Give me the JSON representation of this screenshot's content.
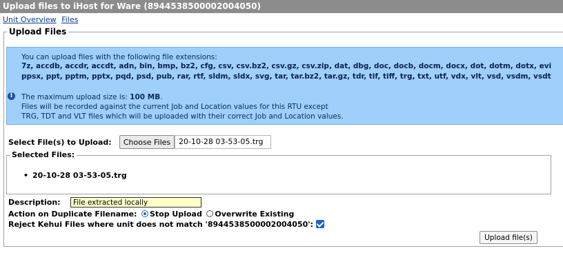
{
  "title": "Upload files to iHost for Ware (8944538500002004050)",
  "nav": {
    "links": [
      "Unit Overview",
      "Files"
    ]
  },
  "upload_section": {
    "legend": "Upload Files",
    "info": {
      "icon": "info-icon",
      "line1": "You can upload files with the following file extensions:",
      "extensions_line1": "7z, accdb, accdr, accdt, adn, bin, bmp, bz2, cfg, csv, csv.bz2, csv.gz, csv.zip, dat, dbg, doc, docb, docm, docx, dot, dotm, dotx, evi",
      "extensions_line2": "ppsx, ppt, pptm, pptx, pqd, psd, pub, rar, rtf, sldm, sldx, svg, tar, tar.bz2, tar.gz, tdr, tif, tiff, trg, txt, utf, vdx, vlt, vsd, vsdm, vsdt",
      "max_label": "The maximum upload size is: ",
      "max_value": "100 MB",
      "max_suffix": ".",
      "note1": "Files will be recorded against the current Job and Location values for this RTU except",
      "note2": "TRG, TDT and VLT files which will be uploaded with their correct Job and Location values."
    },
    "select_label": "Select File(s) to Upload:",
    "choose_button": "Choose Files",
    "chosen_file": "20-10-28 03-53-05.trg",
    "selected_legend": "Selected Files:",
    "selected_files": [
      "20-10-28 03-53-05.trg"
    ],
    "description_label": "Description:",
    "description_value": "File extracted locally",
    "duplicate_label": "Action on Duplicate Filename:",
    "duplicate_options": [
      "Stop Upload",
      "Overwrite Existing"
    ],
    "duplicate_selected": "Stop Upload",
    "reject_label": "Reject Kehui Files where unit does not match '8944538500002004050':",
    "reject_checked": true,
    "upload_button": "Upload file(s)"
  }
}
